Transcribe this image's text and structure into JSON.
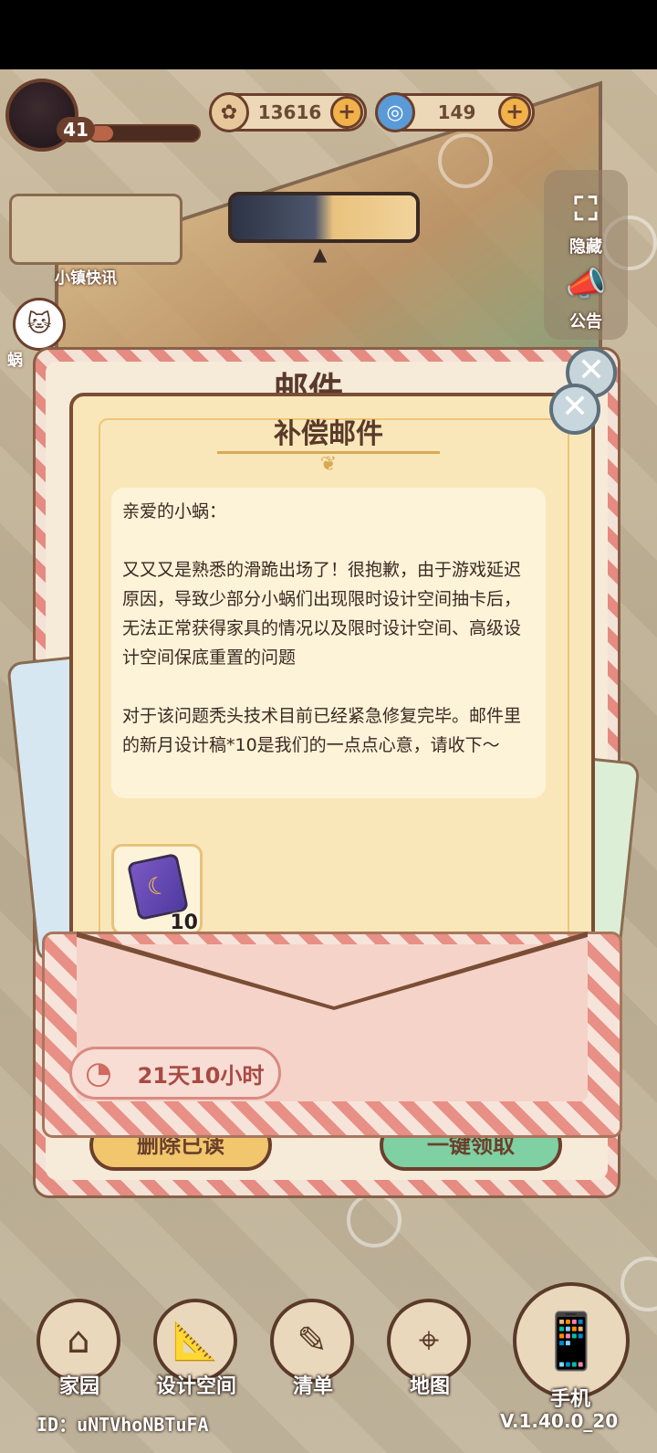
{
  "hud": {
    "level": "41",
    "xp_progress": 0.22,
    "currency_coin": {
      "icon": "coin-icon",
      "value": "13616"
    },
    "currency_gem": {
      "icon": "swirl-gem-icon",
      "value": "149"
    },
    "news_label": "小镇快讯",
    "snail_label": "蜗"
  },
  "side_panel": {
    "hide_label": "隐藏",
    "notice_label": "公告"
  },
  "mailbox": {
    "title": "邮件",
    "delete_read_label": "删除已读",
    "claim_all_label": "一键领取"
  },
  "letter": {
    "title": "补偿邮件",
    "greeting": "亲爱的小蜗：",
    "paragraph1": "又又又是熟悉的滑跪出场了！很抱歉，由于游戏延迟原因，导致少部分小蜗们出现限时设计空间抽卡后，无法正常获得家具的情况以及限时设计空间、高级设计空间保底重置的问题",
    "paragraph2": "对于该问题秃头技术目前已经紧急修复完毕。邮件里的新月设计稿*10是我们的一点点心意，请收下～",
    "reward": {
      "icon": "design-scroll-icon",
      "count": "10"
    },
    "expire_time": "21天10小时"
  },
  "nav": {
    "home": "家园",
    "design": "设计空间",
    "list": "清单",
    "map": "地图",
    "phone": "手机"
  },
  "footer": {
    "id": "ID：uNTVhoNBTuFA",
    "version": "V.1.40.0_20"
  }
}
